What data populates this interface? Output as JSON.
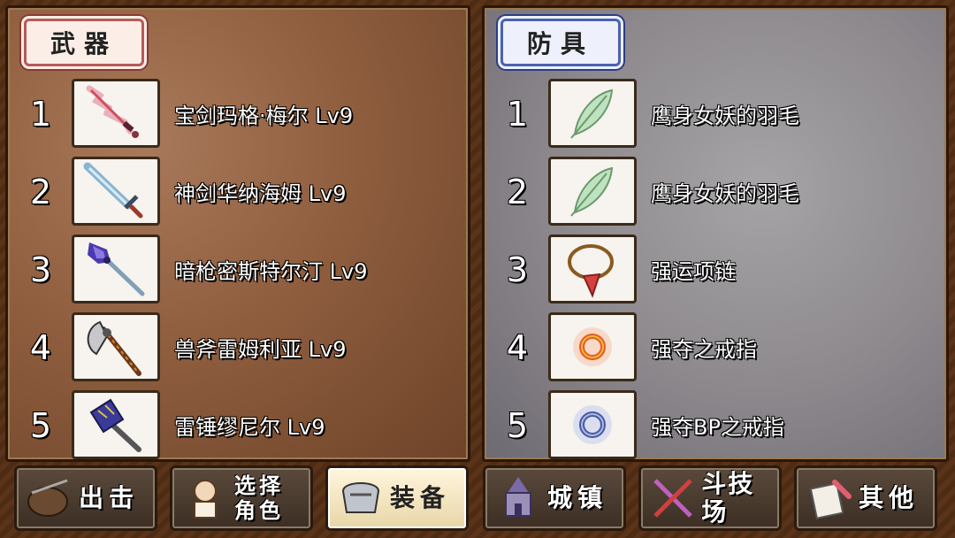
{
  "weapons": {
    "tab_label": "武器",
    "items": [
      {
        "num": "1",
        "name": "宝剑玛格·梅尔 Lv9",
        "icon": "pink-sword-icon"
      },
      {
        "num": "2",
        "name": "神剑华纳海姆 Lv9",
        "icon": "blue-sword-icon"
      },
      {
        "num": "3",
        "name": "暗枪密斯特尔汀 Lv9",
        "icon": "dark-spear-icon"
      },
      {
        "num": "4",
        "name": "兽斧雷姆利亚 Lv9",
        "icon": "axe-icon"
      },
      {
        "num": "5",
        "name": "雷锤缪尼尔 Lv9",
        "icon": "hammer-icon"
      }
    ]
  },
  "armor": {
    "tab_label": "防具",
    "items": [
      {
        "num": "1",
        "name": "鹰身女妖的羽毛",
        "icon": "feather-icon"
      },
      {
        "num": "2",
        "name": "鹰身女妖的羽毛",
        "icon": "feather-icon"
      },
      {
        "num": "3",
        "name": "强运项链",
        "icon": "necklace-icon"
      },
      {
        "num": "4",
        "name": "强夺之戒指",
        "icon": "red-ring-icon"
      },
      {
        "num": "5",
        "name": "强夺BP之戒指",
        "icon": "blue-ring-icon"
      }
    ]
  },
  "nav": {
    "sortie": "出击",
    "select_line1": "选择",
    "select_line2": "角色",
    "equip": "装备",
    "town": "城镇",
    "arena": "斗技场",
    "other": "其他",
    "active": "equip"
  },
  "colors": {
    "weapon_tag_border": "#b85a58",
    "armor_tag_border": "#4a62b0",
    "active_button": "#fff6dc"
  }
}
